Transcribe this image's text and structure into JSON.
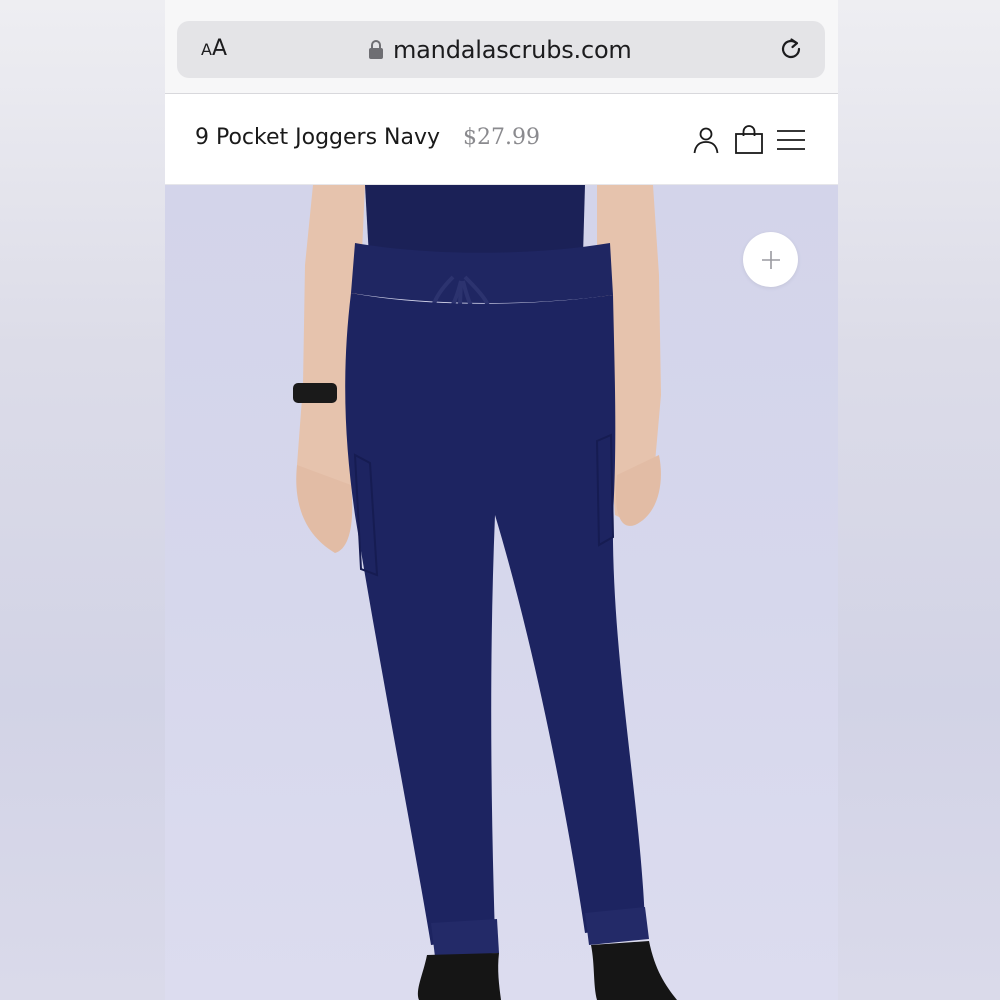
{
  "browser": {
    "text_size_label_small": "A",
    "text_size_label_large": "A",
    "url": "mandalascrubs.com"
  },
  "header": {
    "product_title": "9 Pocket Joggers Navy",
    "price": "$27.99"
  },
  "icons": {
    "lock": "lock-icon",
    "reload": "reload-icon",
    "account": "account-icon",
    "bag": "shopping-bag-icon",
    "menu": "hamburger-menu-icon",
    "zoom": "plus-icon"
  },
  "colors": {
    "product_navy": "#1c2360",
    "hero_background": "#d5d6eb",
    "text_primary": "#1a1a1a",
    "price_gray": "#8a8a8e"
  }
}
